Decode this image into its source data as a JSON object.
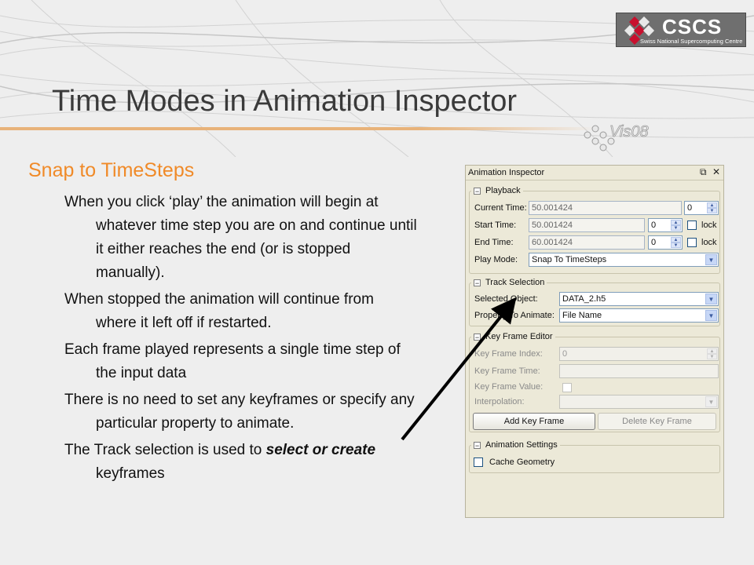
{
  "slide": {
    "title": "Time Modes in Animation Inspector",
    "heading": "Snap to TimeSteps",
    "bullets": [
      "When you click ‘play’ the animation will begin at whatever time step you are on and continue until it either reaches the end (or is stopped manually).",
      "When stopped the animation will continue from where it left off if restarted.",
      "Each frame played represents a single time step of the input data",
      "There is no need to set any keyframes or specify any particular property to animate."
    ],
    "last_bullet": {
      "pre": "The Track selection is used to ",
      "emph": "select or create",
      "post": " keyframes"
    }
  },
  "logo": {
    "main": "CSCS",
    "sub": "Swiss National Supercomputing Centre"
  },
  "vis_logo": {
    "text": "Vis08"
  },
  "colors": {
    "heading": "#f08a28",
    "title": "#3a3a3a",
    "panel_bg": "#ece9d8",
    "arrow": "#000000"
  },
  "panel": {
    "title": "Animation Inspector",
    "float_icon": "⧉",
    "close_icon": "✕",
    "playback": {
      "label": "Playback",
      "current_time_label": "Current Time:",
      "current_time_value": "50.001424",
      "current_index": "0",
      "start_time_label": "Start Time:",
      "start_time_value": "50.001424",
      "start_index": "0",
      "end_time_label": "End Time:",
      "end_time_value": "60.001424",
      "end_index": "0",
      "lock_label": "lock",
      "play_mode_label": "Play Mode:",
      "play_mode_value": "Snap To TimeSteps"
    },
    "track": {
      "label": "Track Selection",
      "selected_object_label": "Selected Object:",
      "selected_object_value": "DATA_2.h5",
      "property_label": "Property To Animate:",
      "property_value": "File Name"
    },
    "keyframe": {
      "label": "Key Frame Editor",
      "index_label": "Key Frame Index:",
      "index_value": "0",
      "time_label": "Key Frame Time:",
      "value_label": "Key Frame Value:",
      "interp_label": "Interpolation:",
      "add_label": "Add Key Frame",
      "delete_label": "Delete Key Frame"
    },
    "settings": {
      "label": "Animation Settings",
      "cache_label": "Cache Geometry"
    }
  }
}
